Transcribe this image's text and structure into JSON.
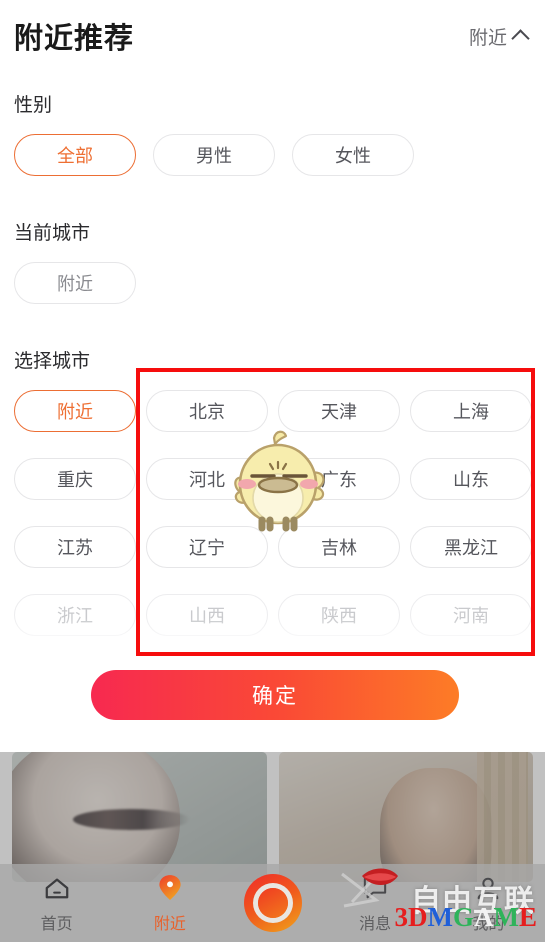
{
  "header": {
    "title": "附近推荐",
    "right_label": "附近",
    "chevron_icon": "chevron-up-icon"
  },
  "sections": {
    "gender_label": "性别",
    "current_city_label": "当前城市",
    "choose_city_label": "选择城市"
  },
  "gender": {
    "options": [
      {
        "label": "全部",
        "selected": true
      },
      {
        "label": "男性",
        "selected": false
      },
      {
        "label": "女性",
        "selected": false
      }
    ]
  },
  "current_city": {
    "value": "附近"
  },
  "cities": {
    "rows": [
      [
        {
          "label": "附近",
          "selected": true,
          "faded": false
        },
        {
          "label": "北京",
          "selected": false,
          "faded": false
        },
        {
          "label": "天津",
          "selected": false,
          "faded": false
        },
        {
          "label": "上海",
          "selected": false,
          "faded": false
        }
      ],
      [
        {
          "label": "重庆",
          "selected": false,
          "faded": false
        },
        {
          "label": "河北",
          "selected": false,
          "faded": false
        },
        {
          "label": "广东",
          "selected": false,
          "faded": false
        },
        {
          "label": "山东",
          "selected": false,
          "faded": false
        }
      ],
      [
        {
          "label": "江苏",
          "selected": false,
          "faded": false
        },
        {
          "label": "辽宁",
          "selected": false,
          "faded": false
        },
        {
          "label": "吉林",
          "selected": false,
          "faded": false
        },
        {
          "label": "黑龙江",
          "selected": false,
          "faded": false
        }
      ],
      [
        {
          "label": "浙江",
          "selected": false,
          "faded": true
        },
        {
          "label": "山西",
          "selected": false,
          "faded": true
        },
        {
          "label": "陕西",
          "selected": false,
          "faded": true
        },
        {
          "label": "河南",
          "selected": false,
          "faded": true
        }
      ]
    ]
  },
  "annotation": {
    "highlight_color": "#f60d0d",
    "name": "red-highlight-box"
  },
  "mascot": {
    "name": "chick-mascot-sticker"
  },
  "confirm": {
    "label": "确定",
    "gradient_from": "#f72950",
    "gradient_to": "#fd7c26"
  },
  "bottom_nav": {
    "items": [
      {
        "label": "首页",
        "icon": "home-icon",
        "active": false
      },
      {
        "label": "附近",
        "icon": "location-pin-icon",
        "active": true
      },
      {
        "label": "消息",
        "icon": "message-icon",
        "active": false
      },
      {
        "label": "我的",
        "icon": "user-icon",
        "active": false
      }
    ],
    "center": {
      "icon": "record-button-icon"
    },
    "active_color": "#e8622c"
  },
  "watermark": {
    "cn_text": "自由互联",
    "brand_3": "3",
    "brand_d": "D",
    "brand_m": "M",
    "brand_g": "G",
    "brand_a": "A",
    "brand_m2": "M",
    "brand_e": "E"
  }
}
